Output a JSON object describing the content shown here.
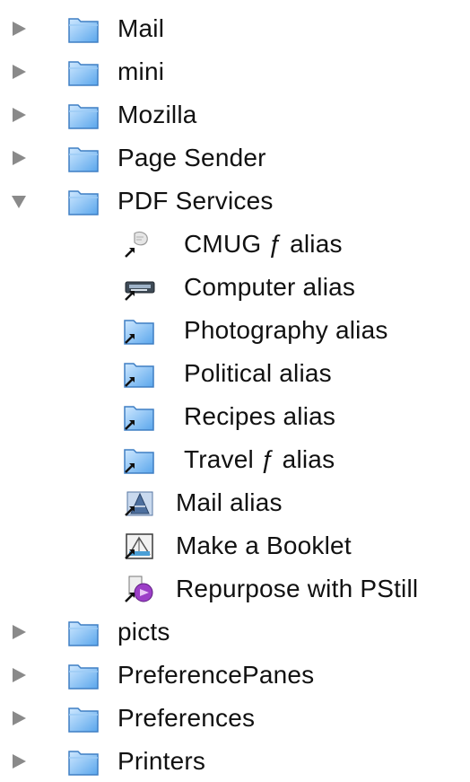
{
  "colors": {
    "disclosure_triangle": "#8a8a8a",
    "folder_blue": "#6fb3f0",
    "folder_light": "#cfe8ff",
    "text": "#111111",
    "background": "#ffffff"
  },
  "tree": {
    "items": [
      {
        "label": "Mail",
        "icon": "folder-icon",
        "disclosure": "collapsed"
      },
      {
        "label": "mini",
        "icon": "folder-icon",
        "disclosure": "collapsed"
      },
      {
        "label": "Mozilla",
        "icon": "folder-icon",
        "disclosure": "collapsed"
      },
      {
        "label": "Page Sender",
        "icon": "folder-icon",
        "disclosure": "collapsed"
      },
      {
        "label": "PDF Services",
        "icon": "folder-icon",
        "disclosure": "expanded"
      },
      {
        "label": "CMUG ƒ alias",
        "icon": "alias-generic-icon"
      },
      {
        "label": "Computer alias",
        "icon": "alias-computer-icon"
      },
      {
        "label": "Photography alias",
        "icon": "alias-folder-icon"
      },
      {
        "label": "Political alias",
        "icon": "alias-folder-icon"
      },
      {
        "label": "Recipes alias",
        "icon": "alias-folder-icon"
      },
      {
        "label": "Travel ƒ alias",
        "icon": "alias-folder-icon"
      },
      {
        "label": "Mail alias",
        "icon": "mail-app-alias-icon"
      },
      {
        "label": "Make a Booklet",
        "icon": "booklet-app-alias-icon"
      },
      {
        "label": "Repurpose with PStill",
        "icon": "pstill-app-alias-icon"
      },
      {
        "label": "picts",
        "icon": "folder-icon",
        "disclosure": "collapsed"
      },
      {
        "label": "PreferencePanes",
        "icon": "folder-icon",
        "disclosure": "collapsed"
      },
      {
        "label": "Preferences",
        "icon": "folder-icon",
        "disclosure": "collapsed"
      },
      {
        "label": "Printers",
        "icon": "folder-icon",
        "disclosure": "collapsed"
      }
    ]
  }
}
